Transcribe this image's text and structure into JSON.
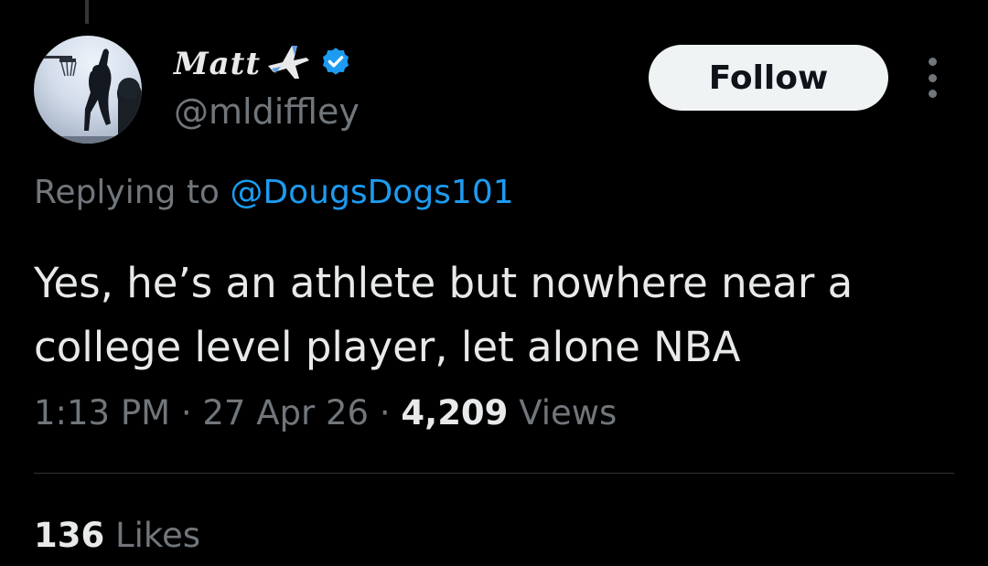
{
  "author": {
    "display_name": "Matt",
    "handle": "@mldiffley",
    "name_emoji_icon": "airplane-icon",
    "verified_icon": "verified-badge-icon"
  },
  "actions": {
    "follow_label": "Follow",
    "more_icon": "more-options-icon"
  },
  "reply": {
    "prefix": "Replying to ",
    "mention": "@DougsDogs101"
  },
  "tweet": {
    "text": "Yes, he’s an athlete but nowhere near a college level player, let alone NBA",
    "time": "1:13 PM",
    "separator": " · ",
    "date": "27 Apr 26",
    "views_count": "4,209",
    "views_label": " Views"
  },
  "engagement": {
    "likes_count": "136",
    "likes_label": " Likes"
  },
  "colors": {
    "background": "#000000",
    "text_primary": "#e7e9ea",
    "text_secondary": "#71767b",
    "accent_blue": "#1d9bf0",
    "follow_button_bg": "#eff3f4"
  }
}
